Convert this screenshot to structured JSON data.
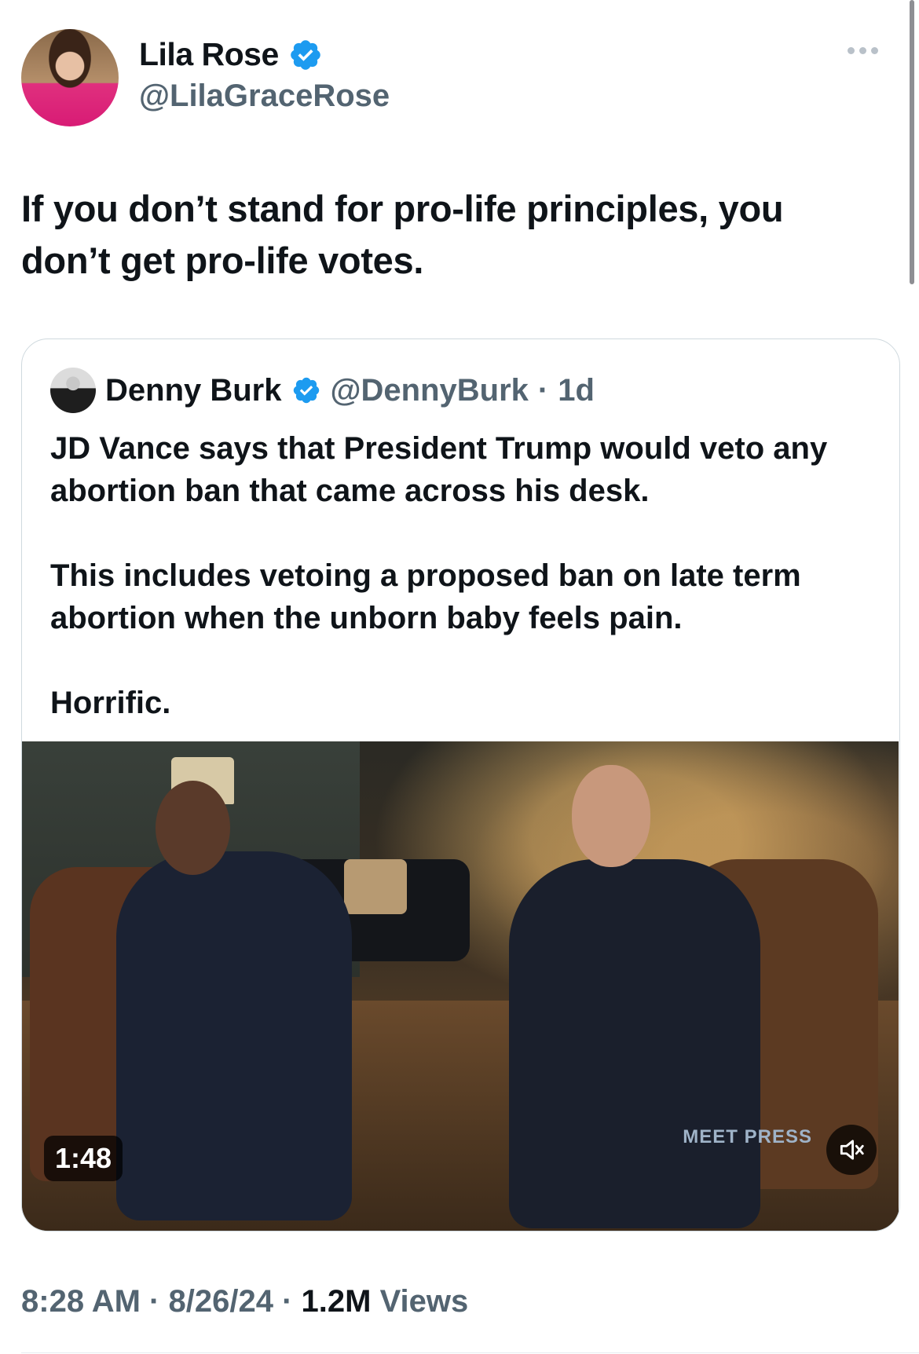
{
  "author": {
    "name": "Lila Rose",
    "handle": "@LilaGraceRose",
    "verified": true,
    "verified_color": "#1d9bf0"
  },
  "tweet": {
    "text": "If you don’t stand for pro-life principles, you don’t get pro-life votes."
  },
  "quoted": {
    "name": "Denny Burk",
    "handle": "@DennyBurk",
    "separator": "·",
    "time": "1d",
    "paragraphs": [
      "JD Vance says that President Trump would veto any abortion ban that came across his desk.",
      "This includes vetoing a proposed ban on late term abortion when the unborn baby feels pain.",
      "Horrific."
    ],
    "video": {
      "duration": "1:48",
      "watermark": "MEET PRESS"
    }
  },
  "meta": {
    "time": "8:28 AM",
    "sep1": "·",
    "date": "8/26/24",
    "sep2": "·",
    "views_count": "1.2M",
    "views_label": "Views"
  },
  "icons": {
    "more": "more-horizontal-icon",
    "verified": "verified-badge-icon",
    "mute": "volume-muted-icon"
  }
}
